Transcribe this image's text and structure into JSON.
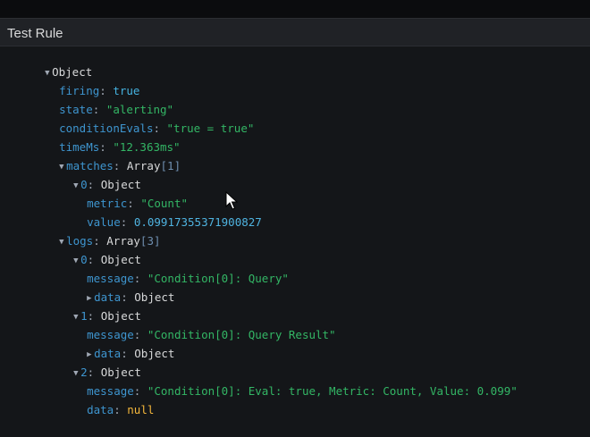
{
  "panel": {
    "title": "Test Rule"
  },
  "tree": {
    "root_type": "Object",
    "firing": {
      "key": "firing",
      "value": "true"
    },
    "state": {
      "key": "state",
      "value": "\"alerting\""
    },
    "conditionEvals": {
      "key": "conditionEvals",
      "value": "\"true = true\""
    },
    "timeMs": {
      "key": "timeMs",
      "value": "\"12.363ms\""
    },
    "matches": {
      "key": "matches",
      "type": "Array",
      "count": "1",
      "items": [
        {
          "index": "0",
          "type": "Object",
          "metric": {
            "key": "metric",
            "value": "\"Count\""
          },
          "value": {
            "key": "value",
            "value": "0.09917355371900827"
          }
        }
      ]
    },
    "logs": {
      "key": "logs",
      "type": "Array",
      "count": "3",
      "items": [
        {
          "index": "0",
          "type": "Object",
          "message": {
            "key": "message",
            "value": "\"Condition[0]: Query\""
          },
          "data": {
            "key": "data",
            "value": "Object"
          }
        },
        {
          "index": "1",
          "type": "Object",
          "message": {
            "key": "message",
            "value": "\"Condition[0]: Query Result\""
          },
          "data": {
            "key": "data",
            "value": "Object"
          }
        },
        {
          "index": "2",
          "type": "Object",
          "message": {
            "key": "message",
            "value": "\"Condition[0]: Eval: true, Metric: Count, Value: 0.099\""
          },
          "data": {
            "key": "data",
            "value": "null"
          }
        }
      ]
    }
  },
  "glyphs": {
    "expanded": "▼",
    "collapsed": "▶",
    "colon": ": "
  }
}
